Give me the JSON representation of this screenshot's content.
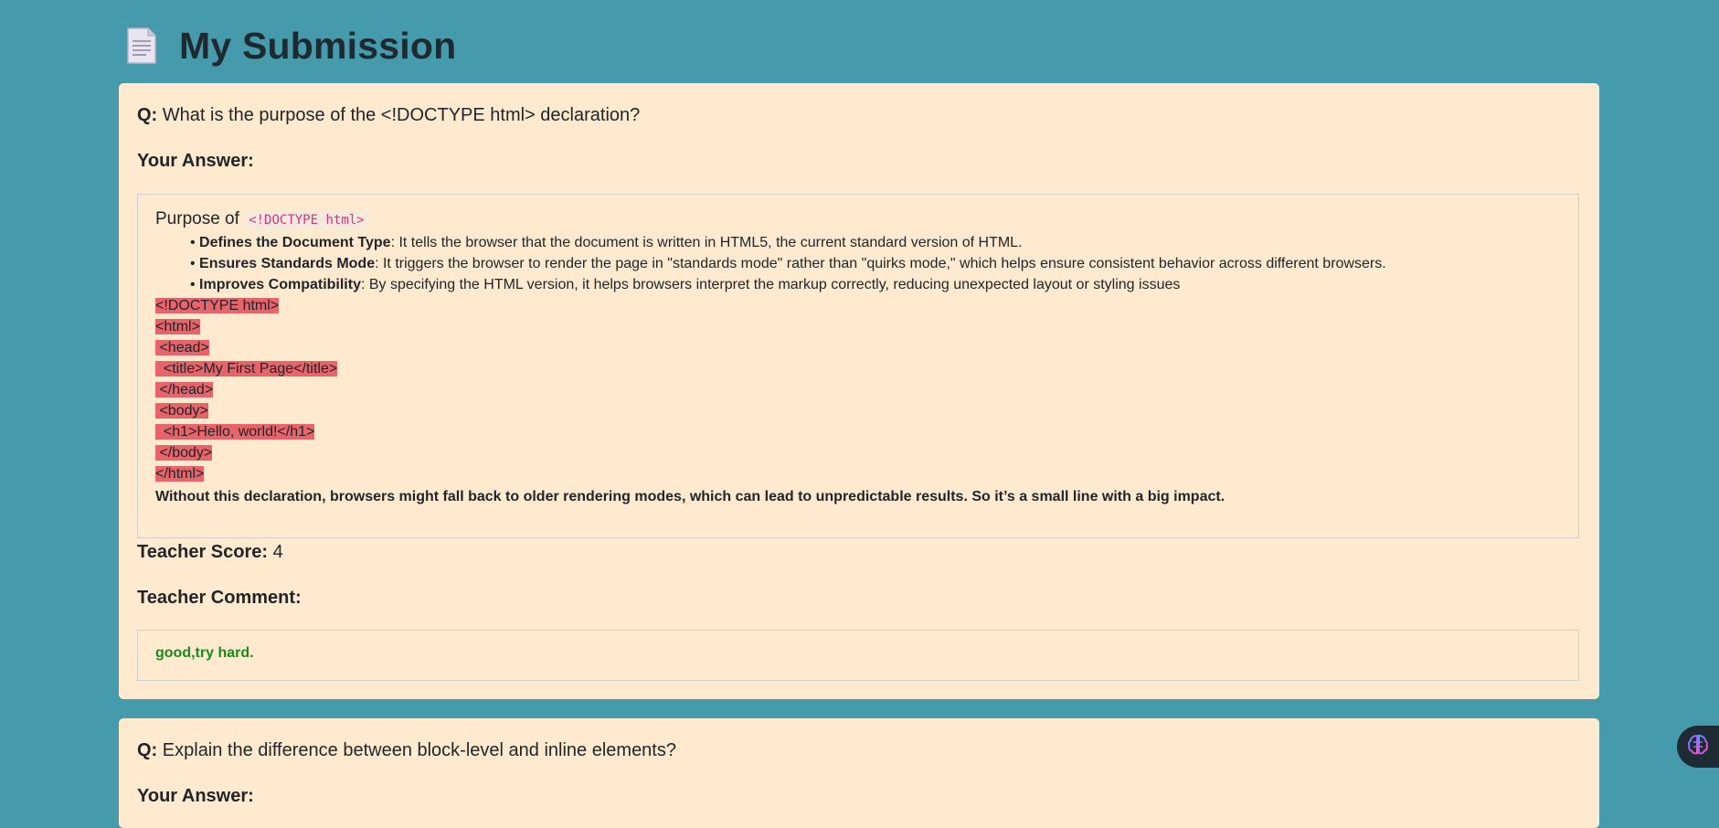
{
  "page": {
    "title": "My Submission",
    "title_icon": "document-icon"
  },
  "questions": [
    {
      "q_prefix": "Q:",
      "question": "What is the purpose of the <!DOCTYPE html> declaration?",
      "answer_label": "Your Answer:",
      "answer": {
        "heading_text": "Purpose of ",
        "heading_code": "<!DOCTYPE html>",
        "bullets": [
          {
            "bold": "Defines the Document Type",
            "text": ": It tells the browser that the document is written in HTML5, the current standard version of HTML."
          },
          {
            "bold": "Ensures Standards Mode",
            "text": ": It triggers the browser to render the page in \"standards mode\" rather than \"quirks mode,\" which helps ensure consistent behavior across different browsers."
          },
          {
            "bold": "Improves Compatibility",
            "text": ": By specifying the HTML version, it helps browsers interpret the markup correctly, reducing unexpected layout or styling issues"
          }
        ],
        "code_lines": [
          "<!DOCTYPE html>",
          "<html>",
          " <head>",
          "  <title>My First Page</title>",
          " </head>",
          " <body>",
          "  <h1>Hello, world!</h1>",
          " </body>",
          "</html>"
        ],
        "summary": "Without this declaration, browsers might fall back to older rendering modes, which can lead to unpredictable results. So it’s a small line with a big impact."
      },
      "score_label": "Teacher Score:",
      "score_value": "4",
      "comment_label": "Teacher Comment:",
      "comment": "good,try hard."
    },
    {
      "q_prefix": "Q:",
      "question": "Explain the difference between block-level and inline elements?",
      "answer_label": "Your Answer:"
    }
  ],
  "floating": {
    "assistant_icon": "brain-icon"
  },
  "colors": {
    "background": "#459aac",
    "card": "#ffead0",
    "highlight": "#e7646a",
    "comment": "#1a8a1a"
  }
}
